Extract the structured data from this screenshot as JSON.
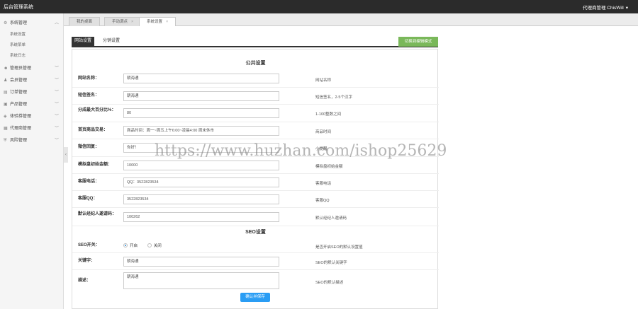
{
  "header": {
    "title": "后台管理系统",
    "user": "代理商管理  ChisWill"
  },
  "sidebar": {
    "groups": [
      {
        "label": "系统管理",
        "items": [
          "系统设置",
          "系统菜单",
          "系统日志"
        ]
      },
      {
        "label": "管理员管理"
      },
      {
        "label": "会员管理"
      },
      {
        "label": "订单管理"
      },
      {
        "label": "产品管理"
      },
      {
        "label": "体验券管理"
      },
      {
        "label": "代理商管理"
      },
      {
        "label": "风险管理"
      }
    ]
  },
  "tabs": [
    {
      "label": "我的桌面"
    },
    {
      "label": "手动调点"
    },
    {
      "label": "系统设置"
    }
  ],
  "subtabs": {
    "active": "网站设置",
    "other": "分销设置"
  },
  "switch_button": "切换到编辑模式",
  "public_section": "公共设置",
  "fields": [
    {
      "label": "网站名称：",
      "value": "朝海通",
      "hint": "网站名称"
    },
    {
      "label": "短信签名：",
      "value": "朝海通",
      "hint": "短信签名，2-5个汉字"
    },
    {
      "label": "分成最大百分比%：",
      "value": "80",
      "hint": "1-100整数之间"
    },
    {
      "label": "首页商品交易：",
      "value": "商品时间：周一~周五上午6:00~凌晨4:00 周末休市",
      "hint": "商品时间"
    },
    {
      "label": "微信回复：",
      "value": "你好！",
      "hint": "小提醒"
    },
    {
      "label": "模拟盘初始金额：",
      "value": "10000",
      "hint": "模拟盘初始金额"
    },
    {
      "label": "客服电话：",
      "value": "QQ：3522823534",
      "hint": "客服电话"
    },
    {
      "label": "客服QQ：",
      "value": "3522823534",
      "hint": "客服QQ"
    },
    {
      "label": "默认经纪人邀请码：",
      "value": "100262",
      "hint": "默认经纪人邀请码"
    }
  ],
  "seo_section": "SEO设置",
  "seo": {
    "switch_label": "SEO开关：",
    "on_label": "开启",
    "off_label": "关闭",
    "switch_hint": "是否开启SEO的默认设置值",
    "keywords_label": "关键字：",
    "keywords_value": "朝海通",
    "keywords_hint": "SEO的默认关键字",
    "desc_label": "描述：",
    "desc_value": "朝海通",
    "desc_hint": "SEO的默认描述"
  },
  "submit_label": "确认并保存",
  "watermark": "https://www.huzhan.com/ishop25629"
}
